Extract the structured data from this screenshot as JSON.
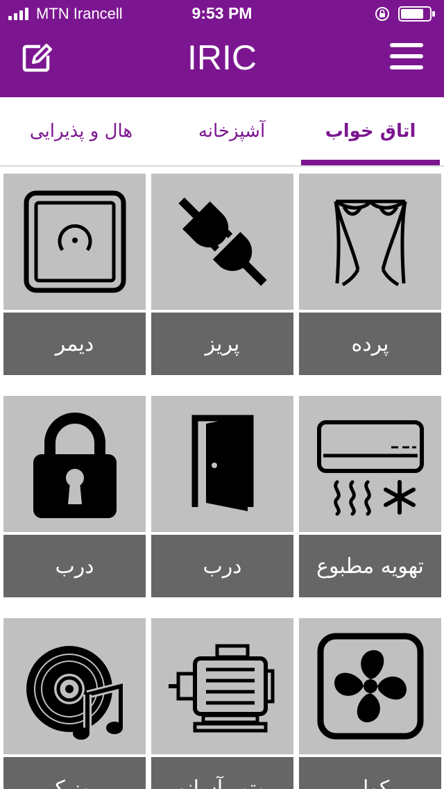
{
  "status_bar": {
    "carrier": "MTN Irancell",
    "time": "9:53 PM"
  },
  "header": {
    "title": "IRIC",
    "left_icon": "edit-icon",
    "right_icon": "hamburger-menu-icon"
  },
  "colors": {
    "brand": "#7b1690",
    "tile_background": "#c0c0c0",
    "label_background": "#666666"
  },
  "tabs": [
    {
      "label": "اتاق خواب",
      "active": true
    },
    {
      "label": "آشپزخانه",
      "active": false
    },
    {
      "label": "هال و پذیرایی",
      "active": false
    }
  ],
  "devices": [
    {
      "label": "پرده",
      "icon": "curtain-icon"
    },
    {
      "label": "پریز",
      "icon": "plug-icon"
    },
    {
      "label": "دیمر",
      "icon": "dimmer-icon"
    },
    {
      "label": "تهویه مطبوع",
      "icon": "air-conditioner-icon"
    },
    {
      "label": "درب",
      "icon": "door-icon"
    },
    {
      "label": "درب",
      "icon": "padlock-icon"
    },
    {
      "label": "کولر",
      "icon": "fan-icon"
    },
    {
      "label": "موتور آسانور",
      "icon": "motor-icon"
    },
    {
      "label": "موزیک",
      "icon": "music-disc-icon"
    }
  ]
}
